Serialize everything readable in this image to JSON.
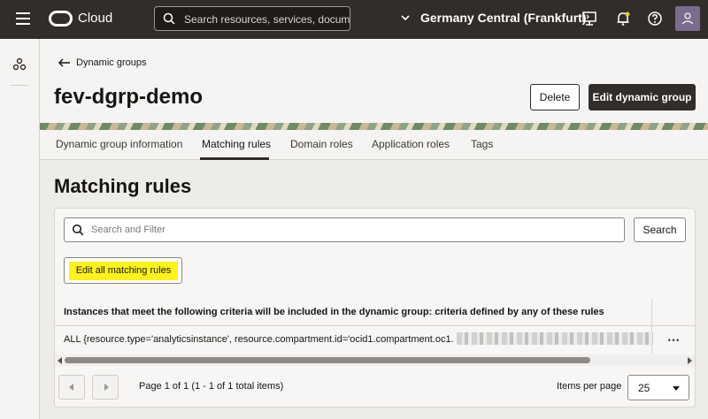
{
  "topbar": {
    "brand": "Cloud",
    "search_placeholder": "Search resources, services, docum",
    "region": "Germany Central (Frankfurt)"
  },
  "breadcrumb": {
    "back_label": "Dynamic groups"
  },
  "header": {
    "title": "fev-dgrp-demo",
    "delete_label": "Delete",
    "edit_label": "Edit dynamic group"
  },
  "tabs": [
    {
      "label": "Dynamic group information"
    },
    {
      "label": "Matching rules"
    },
    {
      "label": "Domain roles"
    },
    {
      "label": "Application roles"
    },
    {
      "label": "Tags"
    }
  ],
  "active_tab": "Matching rules",
  "section": {
    "title": "Matching rules",
    "filter_placeholder": "Search and Filter",
    "search_label": "Search",
    "edit_rules_label": "Edit all matching rules",
    "table_header": "Instances that meet the following criteria will be included in the dynamic group: criteria defined by any of these rules",
    "rule": "ALL {resource.type='analyticsinstance', resource.compartment.id='ocid1.compartment.oc1.",
    "row_menu": "⋯"
  },
  "pagination": {
    "summary": "Page 1 of 1 (1 - 1 of 1 total items)",
    "items_per_page_label": "Items per page",
    "items_per_page_value": "25"
  },
  "colors": {
    "topbar_bg": "#312d2a",
    "highlight": "#fff21a",
    "primary_button": "#312d2a"
  },
  "icons": [
    "menu-icon",
    "oracle-logo-icon",
    "search-icon",
    "chevron-down-icon",
    "cloud-shell-icon",
    "notifications-icon",
    "help-icon",
    "user-avatar-icon",
    "back-arrow-icon",
    "network-icon",
    "kebab-menu-icon"
  ]
}
